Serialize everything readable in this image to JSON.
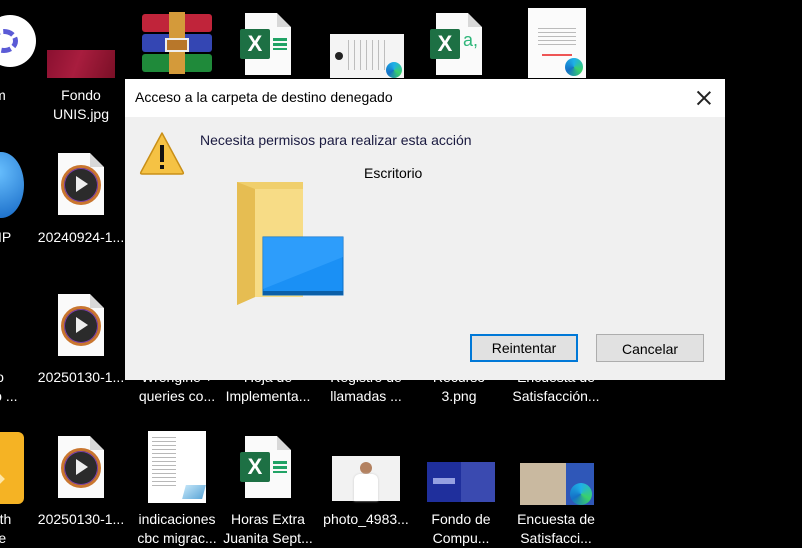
{
  "desktop": {
    "icons": [
      {
        "label_lines": [
          "m"
        ],
        "kind": "app-circle"
      },
      {
        "label_lines": [
          "Fondo",
          "UNIS.jpg"
        ],
        "kind": "image-red"
      },
      {
        "label_lines": [],
        "kind": "winrar"
      },
      {
        "label_lines": [],
        "kind": "excel"
      },
      {
        "label_lines": [],
        "kind": "pdf-edge"
      },
      {
        "label_lines": [],
        "kind": "excel-csv"
      },
      {
        "label_lines": [],
        "kind": "doc-edge"
      },
      {
        "label_lines": [
          "SIP"
        ],
        "kind": "app-blue"
      },
      {
        "label_lines": [
          "20240924-1..."
        ],
        "kind": "video"
      },
      {
        "label_lines": [
          "o",
          "nto ..."
        ],
        "kind": "excel-partial"
      },
      {
        "label_lines": [
          "20250130-1..."
        ],
        "kind": "video"
      },
      {
        "label_lines": [
          "Wrengine +",
          "queries co..."
        ],
        "kind": "hidden"
      },
      {
        "label_lines": [
          "Hoja de",
          "Implementa..."
        ],
        "kind": "hidden"
      },
      {
        "label_lines": [
          "Registro de",
          "llamadas ..."
        ],
        "kind": "hidden"
      },
      {
        "label_lines": [
          "Recurso",
          "3.png"
        ],
        "kind": "hidden"
      },
      {
        "label_lines": [
          "Encuesta de",
          "Satisfacción..."
        ],
        "kind": "hidden"
      },
      {
        "label_lines": [
          "nith",
          "re"
        ],
        "kind": "app-yellow"
      },
      {
        "label_lines": [
          "20250130-1..."
        ],
        "kind": "video"
      },
      {
        "label_lines": [
          "indicaciones",
          "cbc migrac..."
        ],
        "kind": "notepad"
      },
      {
        "label_lines": [
          "Horas Extra",
          "Juanita Sept..."
        ],
        "kind": "excel"
      },
      {
        "label_lines": [
          "photo_4983..."
        ],
        "kind": "photo"
      },
      {
        "label_lines": [
          "Fondo de",
          "Compu..."
        ],
        "kind": "image-blue"
      },
      {
        "label_lines": [
          "Encuesta de",
          "Satisfacci..."
        ],
        "kind": "image-edge"
      }
    ],
    "excel_letter": "X",
    "csv_suffix": "a,"
  },
  "dialog": {
    "title": "Acceso a la carpeta de destino denegado",
    "message": "Necesita permisos para realizar esta acción",
    "target_folder": "Escritorio",
    "buttons": {
      "retry": "Reintentar",
      "cancel": "Cancelar"
    },
    "warning_glyph": "!"
  },
  "colors": {
    "accent": "#0078d7",
    "warning": "#f5c244",
    "dialog_bg": "#f0f0f0"
  }
}
